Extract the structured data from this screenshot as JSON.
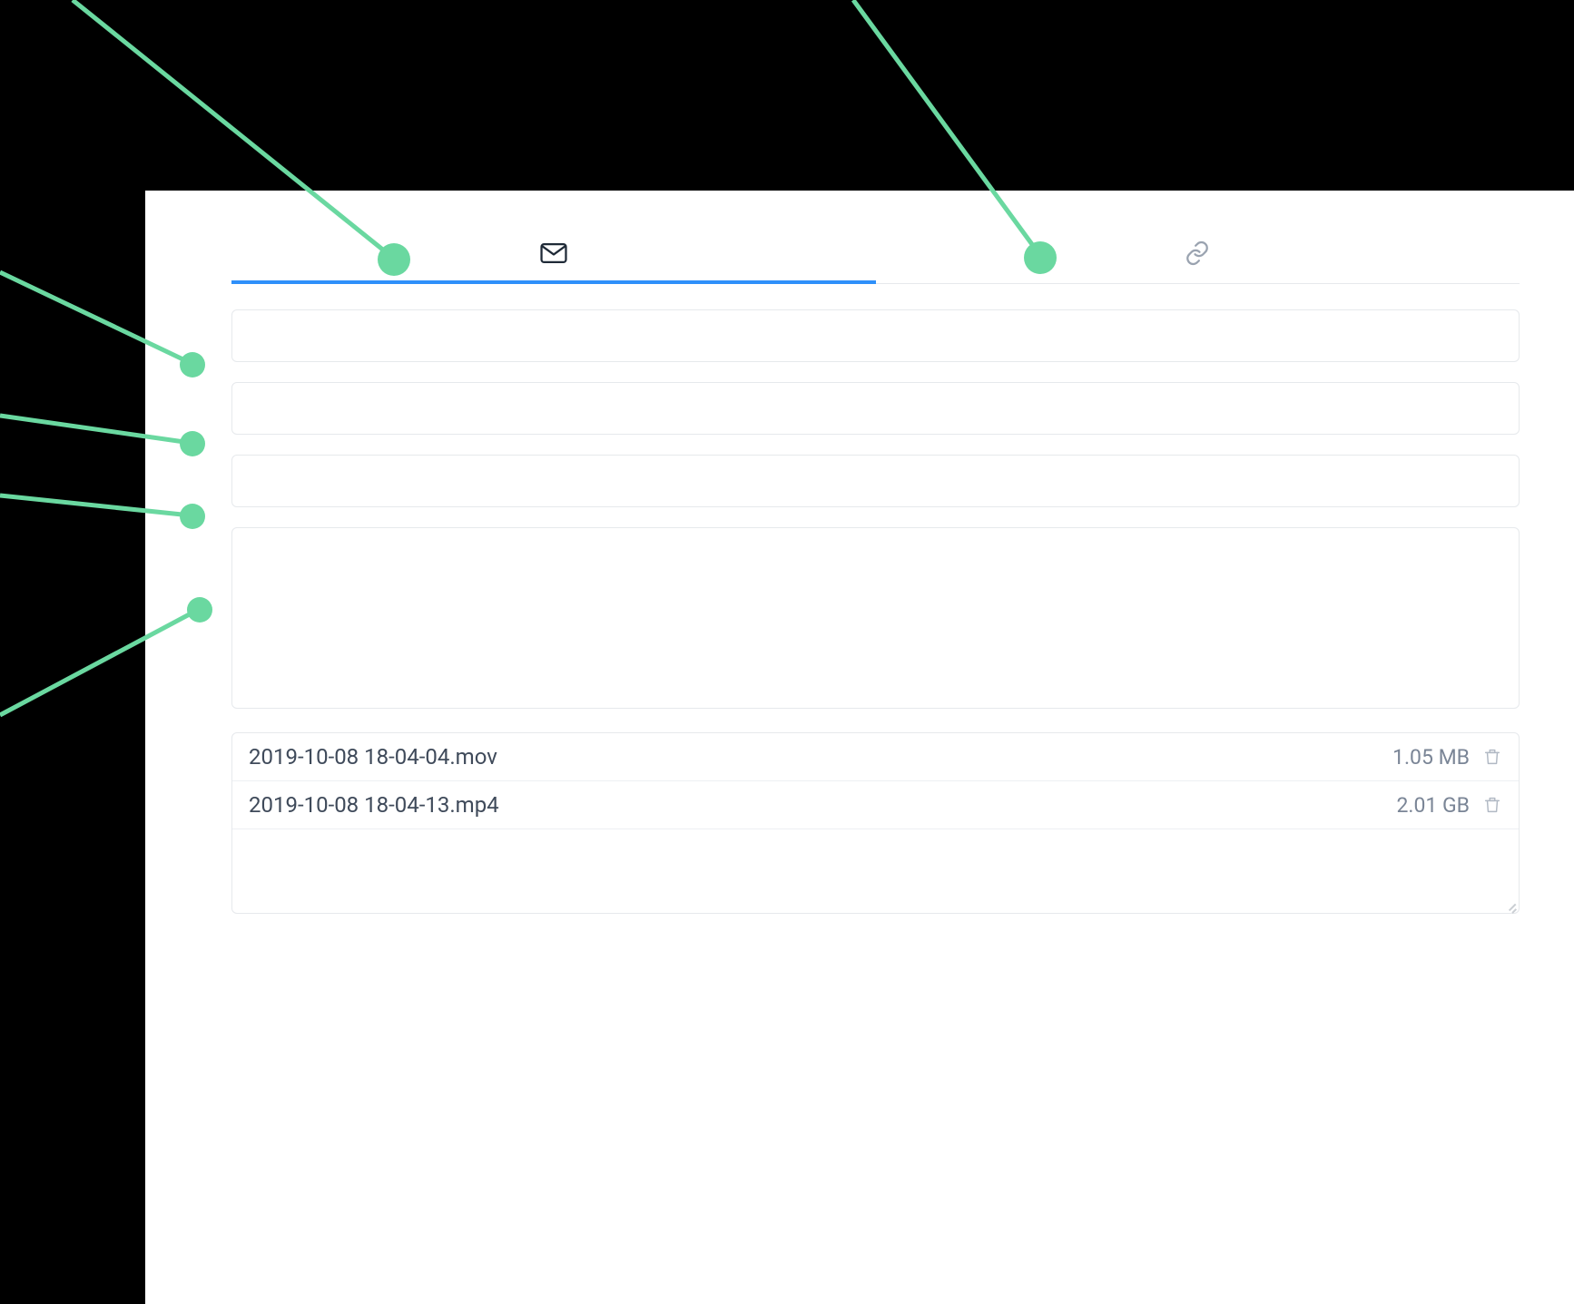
{
  "tabs": {
    "email": {
      "icon": "envelope-icon"
    },
    "link": {
      "icon": "link-icon"
    }
  },
  "form": {
    "to_value": "",
    "from_value": "",
    "subject_value": "",
    "message_value": ""
  },
  "files": [
    {
      "name": "2019-10-08 18-04-04.mov",
      "size": "1.05 MB"
    },
    {
      "name": "2019-10-08 18-04-13.mp4",
      "size": "2.01 GB"
    }
  ],
  "colors": {
    "accent": "#2e90fa",
    "annotation": "#6ad8a0"
  }
}
